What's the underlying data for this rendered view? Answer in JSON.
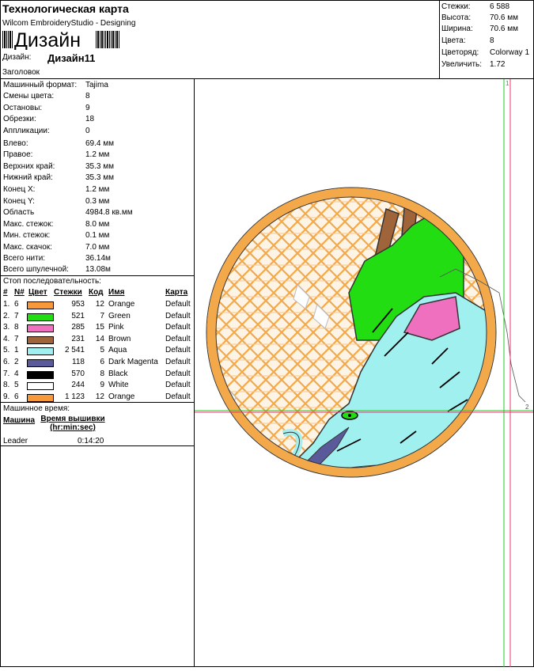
{
  "header": {
    "title": "Технологическая карта",
    "subtitle": "Wilcom EmbroideryStudio - Designing",
    "barcode_text": "Дизайн",
    "design_label": "Дизайн:",
    "design_value": "Дизайн11",
    "heading_label": "Заголовок"
  },
  "stats": [
    {
      "k": "Стежки:",
      "v": "6 588"
    },
    {
      "k": "Высота:",
      "v": "70.6 мм"
    },
    {
      "k": "Ширина:",
      "v": "70.6 мм"
    },
    {
      "k": "Цвета:",
      "v": "8"
    },
    {
      "k": "Цветоряд:",
      "v": "Colorway 1"
    },
    {
      "k": "Увеличить:",
      "v": "1.72"
    }
  ],
  "params": [
    {
      "k": "Машинный формат:",
      "v": "Tajima"
    },
    {
      "k": "Смены цвета:",
      "v": "8"
    },
    {
      "k": "Остановы:",
      "v": "9"
    },
    {
      "k": "Обрезки:",
      "v": "18"
    },
    {
      "k": "Аппликации:",
      "v": "0"
    },
    {
      "k": "Влево:",
      "v": "69.4 мм"
    },
    {
      "k": "Правое:",
      "v": "1.2 мм"
    },
    {
      "k": "Верхних край:",
      "v": "35.3 мм"
    },
    {
      "k": "Нижний край:",
      "v": "35.3 мм"
    },
    {
      "k": "Конец X:",
      "v": "1.2 мм"
    },
    {
      "k": "Конец Y:",
      "v": "0.3 мм"
    },
    {
      "k": "Область",
      "v": "4984.8 кв.мм"
    },
    {
      "k": "Макс. стежок:",
      "v": "8.0 мм"
    },
    {
      "k": "Мин. стежок:",
      "v": "0.1 мм"
    },
    {
      "k": "Макс. скачок:",
      "v": "7.0 мм"
    },
    {
      "k": "Всего нити:",
      "v": "36.14м"
    },
    {
      "k": "Всего шпулечной:",
      "v": "13.08м"
    }
  ],
  "sequence": {
    "title": "Стоп последовательность:",
    "headers": [
      "#",
      "N#",
      "Цвет",
      "Стежки",
      "Код",
      "Имя",
      "Карта"
    ],
    "rows": [
      {
        "n": "1.",
        "nn": "6",
        "color": "#f7993a",
        "stitches": "953",
        "code": "12",
        "name": "Orange",
        "chart": "Default"
      },
      {
        "n": "2.",
        "nn": "7",
        "color": "#22dd11",
        "stitches": "521",
        "code": "7",
        "name": "Green",
        "chart": "Default"
      },
      {
        "n": "3.",
        "nn": "8",
        "color": "#f070c0",
        "stitches": "285",
        "code": "15",
        "name": "Pink",
        "chart": "Default"
      },
      {
        "n": "4.",
        "nn": "7",
        "color": "#a0643a",
        "stitches": "231",
        "code": "14",
        "name": "Brown",
        "chart": "Default"
      },
      {
        "n": "5.",
        "nn": "1",
        "color": "#a0f0f0",
        "stitches": "2 541",
        "code": "5",
        "name": "Aqua",
        "chart": "Default"
      },
      {
        "n": "6.",
        "nn": "2",
        "color": "#5a5a9a",
        "stitches": "118",
        "code": "6",
        "name": "Dark Magenta",
        "chart": "Default"
      },
      {
        "n": "7.",
        "nn": "4",
        "color": "#000000",
        "stitches": "570",
        "code": "8",
        "name": "Black",
        "chart": "Default"
      },
      {
        "n": "8.",
        "nn": "5",
        "color": "#ffffff",
        "stitches": "244",
        "code": "9",
        "name": "White",
        "chart": "Default"
      },
      {
        "n": "9.",
        "nn": "6",
        "color": "#f7993a",
        "stitches": "1 123",
        "code": "12",
        "name": "Orange",
        "chart": "Default"
      }
    ]
  },
  "machine_time": {
    "title": "Машинное время:",
    "col1": "Машина",
    "col2a": "Время вышивки",
    "col2b": "(hr:min:sec)",
    "row_name": "Leader",
    "row_time": "0:14:20"
  },
  "canvas": {
    "marker_1": "1",
    "marker_2": "2"
  }
}
